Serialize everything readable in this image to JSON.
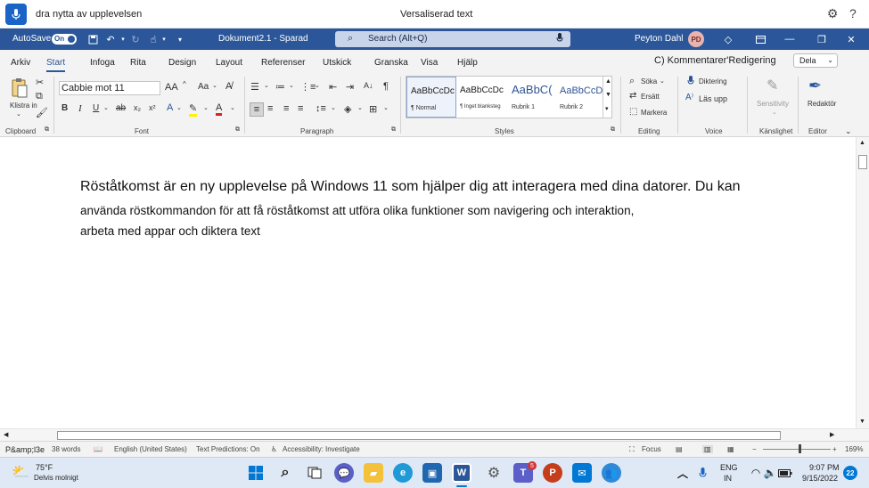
{
  "voice_access": {
    "status": "dra nytta av upplevelsen",
    "center_label": "Versaliserad text"
  },
  "titlebar": {
    "autosave_label": "AutoSave",
    "autosave_state": "On",
    "document_title": "Dokument2.1 - Sparad",
    "search_placeholder": "Search (Alt+Q)",
    "user_name": "Peyton Dahl",
    "user_initials": "PD"
  },
  "tabs": [
    "Arkiv",
    "Start",
    "Infoga",
    "Rita",
    "Design",
    "Layout",
    "Referenser",
    "Utskick",
    "Granska",
    "Visa",
    "Hjälp"
  ],
  "ribbon_right": {
    "comments": "C) Kommentarer",
    "editing": "'Redigering",
    "share": "Dela"
  },
  "ribbon": {
    "clipboard": {
      "paste": "Klistra in",
      "label": "Clipboard"
    },
    "font": {
      "font_name": "Cabbie mot 11",
      "grow": "AA",
      "case": "Aa",
      "label": "Font"
    },
    "paragraph": {
      "label": "Paragraph"
    },
    "styles": {
      "label": "Styles",
      "items": [
        {
          "preview": "AaBbCcDc",
          "name": "¶ Normal"
        },
        {
          "preview": "AaBbCcDc",
          "name": "¶ Inget blanksteg"
        },
        {
          "preview": "AaBbC(",
          "name": "Rubrik 1"
        },
        {
          "preview": "AaBbCcD",
          "name": "Rubrik 2"
        }
      ]
    },
    "editing": {
      "find": "Söka",
      "replace": "Ersätt",
      "select": "Markera",
      "label": "Editing"
    },
    "voice": {
      "dictate": "Diktering",
      "read_aloud": "Läs upp",
      "label": "Voice"
    },
    "sensitivity": {
      "button": "Sensitivity",
      "label": "Känslighet"
    },
    "editor": {
      "button": "Redaktör",
      "label": "Editor"
    }
  },
  "document": {
    "line1": "Röståtkomst är en ny upplevelse på Windows 11 som hjälper dig att interagera med dina datorer. Du kan",
    "line2": "använda röstkommandon för att få röståtkomst att utföra olika funktioner som navigering och interaktion,",
    "line3": "arbeta med appar och diktera text"
  },
  "statusbar": {
    "page": "P&amp;l3e",
    "words": "38 words",
    "language": "English (United States)",
    "predictions": "Text Predictions: On",
    "accessibility": "Accessibility: Investigate",
    "focus": "Focus",
    "zoom": "169%"
  },
  "taskbar": {
    "temperature": "75°F",
    "weather": "Delvis molnigt",
    "teams_badge": "5",
    "lang_top": "ENG",
    "lang_bottom": "IN",
    "time": "9:07 PM",
    "date": "9/15/2022",
    "notif_count": "22"
  },
  "colors": {
    "word_blue": "#2b579a",
    "mic_blue": "#1a64c8",
    "taskbar_bg": "#dfe8f5"
  }
}
